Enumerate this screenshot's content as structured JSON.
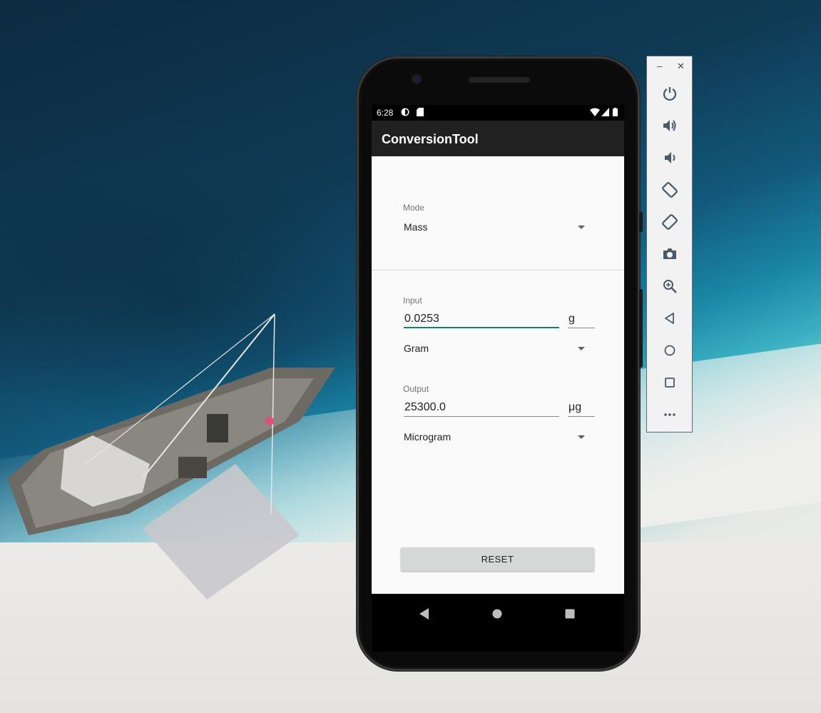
{
  "phone": {
    "status_bar": {
      "time": "6:28"
    },
    "app_bar": {
      "title": "ConversionTool"
    },
    "mode": {
      "label": "Mode",
      "selected": "Mass"
    },
    "input": {
      "label": "Input",
      "value": "0.0253",
      "unit_symbol": "g",
      "unit_selected": "Gram"
    },
    "output": {
      "label": "Output",
      "value": "25300.0",
      "unit_symbol": "μg",
      "unit_selected": "Microgram"
    },
    "reset_label": "RESET",
    "accent_color": "#00897b",
    "app_bar_color": "#212121"
  },
  "emulator_toolbar": {
    "items": [
      "power-icon",
      "volume-up-icon",
      "volume-down-icon",
      "rotate-left-icon",
      "rotate-right-icon",
      "camera-icon",
      "zoom-icon",
      "back-icon",
      "home-icon",
      "overview-icon",
      "more-icon"
    ]
  }
}
